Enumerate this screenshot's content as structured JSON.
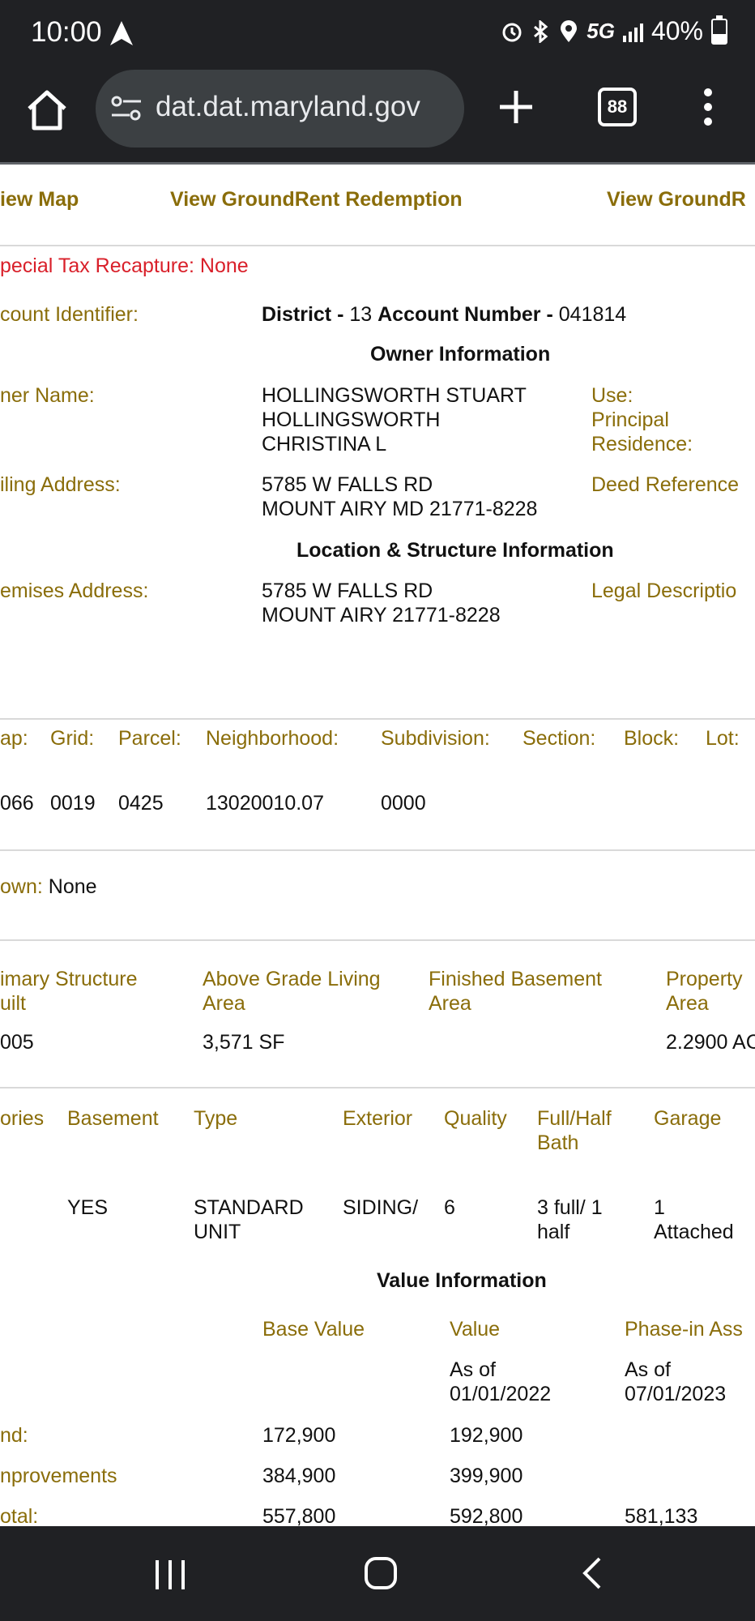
{
  "status_bar": {
    "time": "10:00",
    "network": "5G",
    "battery": "40%",
    "battery_level": 0.4,
    "icons": [
      "navigation-arrow-icon",
      "alarm-icon",
      "bluetooth-icon",
      "location-icon",
      "signal-icon",
      "battery-icon"
    ]
  },
  "browser": {
    "url": "dat.dat.maryland.gov",
    "tab_count": "88"
  },
  "links": {
    "view_map": "iew Map",
    "ground_rent_redemption": "View GroundRent Redemption",
    "ground_rent_registration": "View GroundR"
  },
  "property": {
    "special_tax_recapture": "pecial Tax Recapture: None",
    "account_identifier_label": "count Identifier:",
    "district_label": "District -",
    "district_value": "13",
    "account_number_label": "Account Number -",
    "account_number_value": "041814",
    "owner_info_heading": "Owner Information",
    "owner_name_label": "ner Name:",
    "owner_name_lines": [
      "HOLLINGSWORTH STUART",
      "HOLLINGSWORTH",
      "CHRISTINA L"
    ],
    "use_label": "Use:",
    "principal_residence_lines": [
      "Principal",
      "Residence:"
    ],
    "mailing_address_label": "iling Address:",
    "mailing_address_lines": [
      "5785 W FALLS RD",
      "MOUNT AIRY MD 21771-8228"
    ],
    "deed_reference_label": "Deed Reference",
    "location_heading": "Location & Structure Information",
    "premises_address_label": "emises Address:",
    "premises_address_lines": [
      "5785 W FALLS RD",
      "MOUNT AIRY 21771-8228"
    ],
    "legal_description_label": "Legal Descriptio"
  },
  "parcel_table": {
    "headers": [
      "ap:",
      "Grid:",
      "Parcel:",
      "Neighborhood:",
      "Subdivision:",
      "Section:",
      "Block:",
      "Lot:"
    ],
    "values": [
      "066",
      "0019",
      "0425",
      "13020010.07",
      "0000",
      "",
      "",
      ""
    ]
  },
  "town": {
    "label": "own:",
    "value": "None"
  },
  "structure_table": {
    "headers": [
      [
        "imary Structure",
        "uilt"
      ],
      [
        "Above Grade Living",
        "Area"
      ],
      [
        "Finished Basement",
        "Area"
      ],
      [
        "Property",
        "Area"
      ]
    ],
    "values": [
      "005",
      "3,571 SF",
      "",
      "2.2900 AC"
    ]
  },
  "features_table": {
    "headers": [
      [
        "ories"
      ],
      [
        "Basement"
      ],
      [
        "Type"
      ],
      [
        "Exterior"
      ],
      [
        "Quality"
      ],
      [
        "Full/Half",
        "Bath"
      ],
      [
        "Garage"
      ]
    ],
    "values": [
      [
        ""
      ],
      [
        "YES"
      ],
      [
        "STANDARD",
        "UNIT"
      ],
      [
        "SIDING/"
      ],
      [
        "6"
      ],
      [
        "3 full/ 1",
        "half"
      ],
      [
        "1",
        "Attached"
      ]
    ]
  },
  "value_info": {
    "heading": "Value Information",
    "headers": [
      "Base Value",
      "Value",
      "Phase-in Ass"
    ],
    "as_of_value": [
      "As of",
      "01/01/2022"
    ],
    "as_of_phase": [
      "As of",
      "07/01/2023"
    ],
    "rows": [
      {
        "label": "nd:",
        "base": "172,900",
        "value": "192,900",
        "phase": ""
      },
      {
        "label": "nprovements",
        "base": "384,900",
        "value": "399,900",
        "phase": ""
      },
      {
        "label": "otal:",
        "base": "557,800",
        "value": "592,800",
        "phase": "581,133"
      }
    ]
  },
  "colors": {
    "label_gold": "#8a6d0a",
    "alert_red": "#d9202a",
    "chrome_dark": "#202124"
  }
}
